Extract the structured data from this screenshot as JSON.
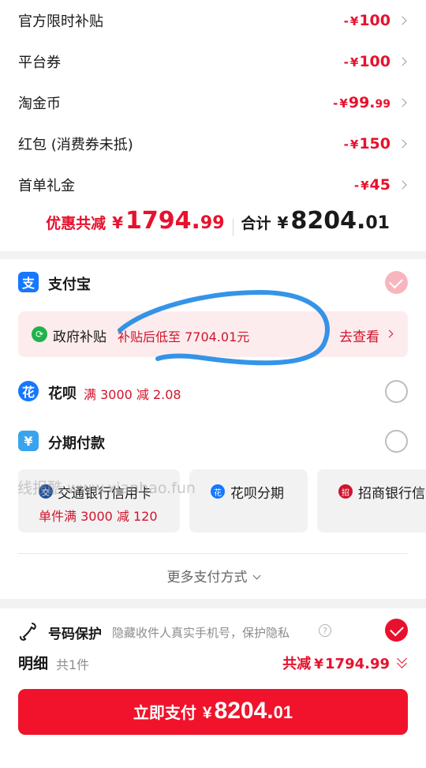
{
  "discounts": [
    {
      "label": "官方限时补贴",
      "minus": "-",
      "yen": "¥",
      "int": "100",
      "dec": ""
    },
    {
      "label": "平台券",
      "minus": "-",
      "yen": "¥",
      "int": "100",
      "dec": ""
    },
    {
      "label": "淘金币",
      "minus": "-",
      "yen": "¥",
      "int": "99.",
      "dec": "99"
    },
    {
      "label": "红包 (消费券未抵)",
      "minus": "-",
      "yen": "¥",
      "int": "150",
      "dec": ""
    },
    {
      "label": "首单礼金",
      "minus": "-",
      "yen": "¥",
      "int": "45",
      "dec": ""
    }
  ],
  "summary": {
    "discount_label": "优惠共减",
    "yen": "¥",
    "discount_int": "1794.",
    "discount_dec": "99",
    "total_label": "合计",
    "total_int": "8204.",
    "total_dec": "01"
  },
  "payment": {
    "alipay": {
      "label": "支付宝",
      "icon": "支",
      "selected": true
    },
    "gov_subsidy": {
      "title": "政府补贴",
      "desc": "补贴后低至 7704.01元",
      "link": "去查看"
    },
    "huabei": {
      "label": "花呗",
      "desc": "满 3000 减 2.08",
      "icon": "花",
      "selected": false
    },
    "installment": {
      "label": "分期付款",
      "icon": "¥",
      "selected": false
    },
    "cards": [
      {
        "title": "交通银行信用卡",
        "desc": "单件满 3000 减 120",
        "icon": "交"
      },
      {
        "title": "花呗分期",
        "desc": "",
        "icon": "花"
      },
      {
        "title": "招商银行信",
        "desc": "",
        "icon": "招"
      }
    ],
    "more_label": "更多支付方式"
  },
  "watermark": "线报酷 www.xianbao.fun",
  "protection": {
    "title": "号码保护",
    "desc": "隐藏收件人真实手机号，保护隐私",
    "help": "?",
    "checked": true
  },
  "detail": {
    "title": "明细",
    "count": "共1件",
    "total_label": "共减",
    "yen": "¥",
    "value": "1794.99"
  },
  "pay_button": {
    "label": "立即支付",
    "yen": "¥",
    "int": "8204.",
    "dec": "01"
  },
  "colors": {
    "brand_red": "#e8112d",
    "alipay_blue": "#1677ff",
    "annotation_blue": "#1e88e5"
  }
}
